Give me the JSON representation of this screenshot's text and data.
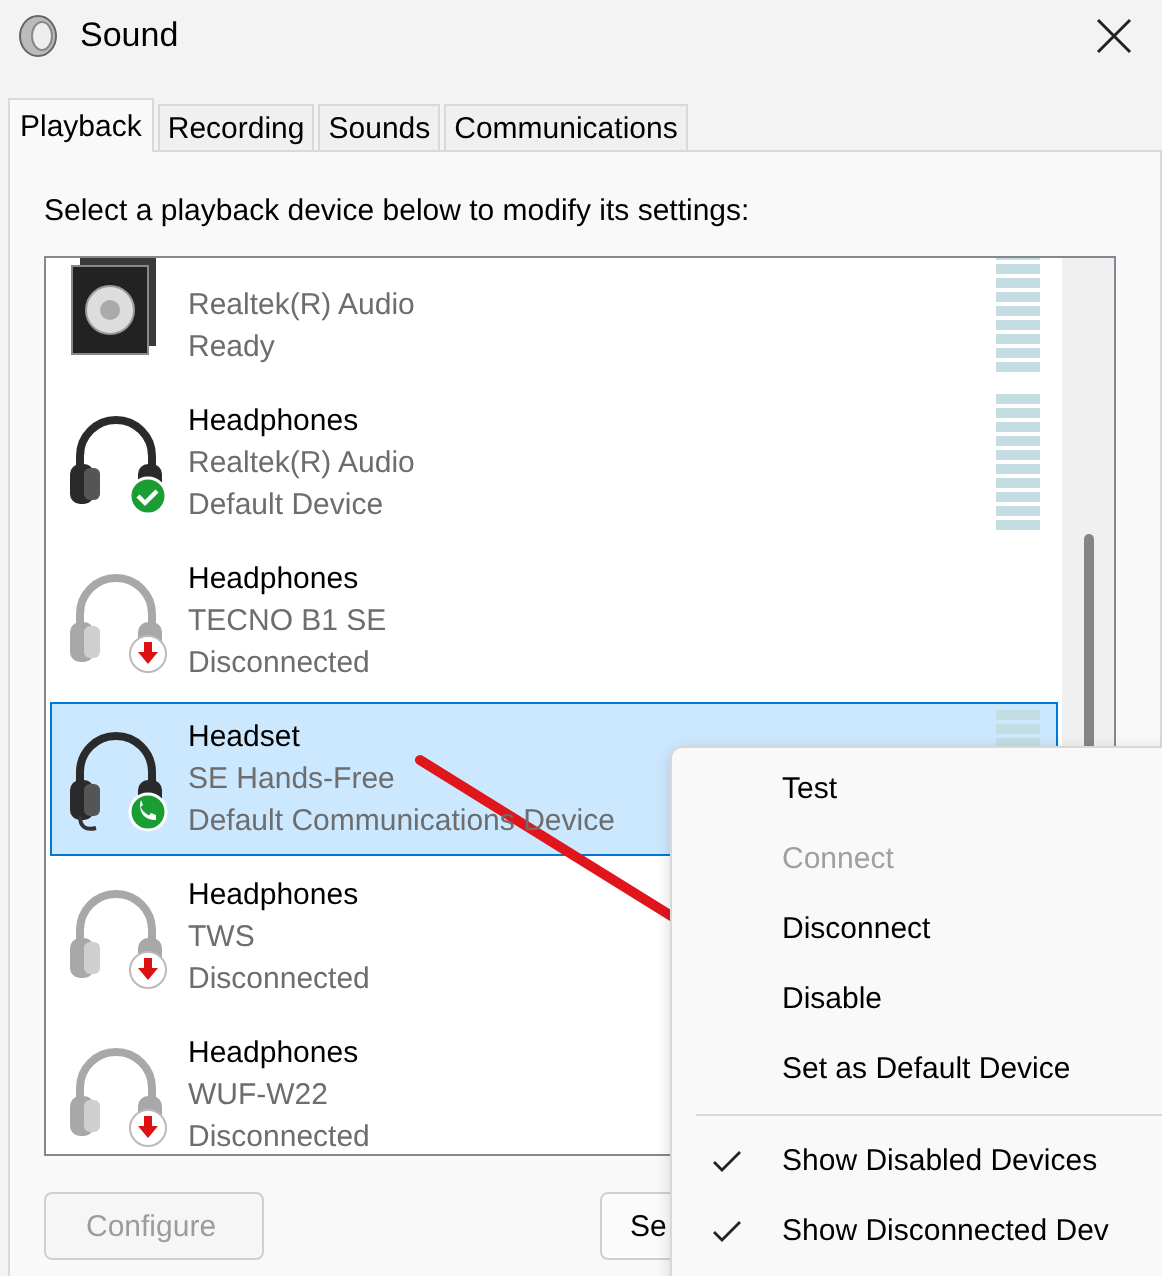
{
  "window": {
    "title": "Sound"
  },
  "tabs": [
    {
      "label": "Playback",
      "selected": true
    },
    {
      "label": "Recording",
      "selected": false
    },
    {
      "label": "Sounds",
      "selected": false
    },
    {
      "label": "Communications",
      "selected": false
    }
  ],
  "instruction": "Select a playback device below to modify its settings:",
  "devices": [
    {
      "driver": "Realtek(R) Audio",
      "status": "Ready",
      "kind": "speaker",
      "meter": true,
      "selected": false
    },
    {
      "name": "Headphones",
      "driver": "Realtek(R) Audio",
      "status": "Default Device",
      "kind": "default_headphones",
      "meter": true,
      "selected": false
    },
    {
      "name": "Headphones",
      "driver": "TECNO B1 SE",
      "status": "Disconnected",
      "kind": "disconnected_headphones",
      "meter": false,
      "selected": false
    },
    {
      "name": "Headset",
      "driver": "SE Hands-Free",
      "status": "Default Communications Device",
      "kind": "communications_headset",
      "meter": true,
      "selected": true
    },
    {
      "name": "Headphones",
      "driver": "TWS",
      "status": "Disconnected",
      "kind": "disconnected_headphones",
      "selected": false
    },
    {
      "name": "Headphones",
      "driver": "WUF-W22",
      "status": "Disconnected",
      "kind": "disconnected_headphones",
      "selected": false
    }
  ],
  "buttons": [
    {
      "label": "Configure",
      "disabled": true
    },
    {
      "label": "Se",
      "disabled": false
    }
  ],
  "context_menu": [
    {
      "kind": "item",
      "label": "Test",
      "disabled": false,
      "checked": false
    },
    {
      "kind": "item",
      "label": "Connect",
      "disabled": true,
      "checked": false
    },
    {
      "kind": "item",
      "label": "Disconnect",
      "disabled": false,
      "checked": false
    },
    {
      "kind": "item",
      "label": "Disable",
      "disabled": false,
      "checked": false
    },
    {
      "kind": "item",
      "label": "Set as Default Device",
      "disabled": false,
      "checked": false
    },
    {
      "kind": "separator"
    },
    {
      "kind": "item",
      "label": "Show Disabled Devices",
      "disabled": false,
      "checked": true
    },
    {
      "kind": "item",
      "label": "Show Disconnected Dev",
      "disabled": false,
      "checked": true
    }
  ]
}
